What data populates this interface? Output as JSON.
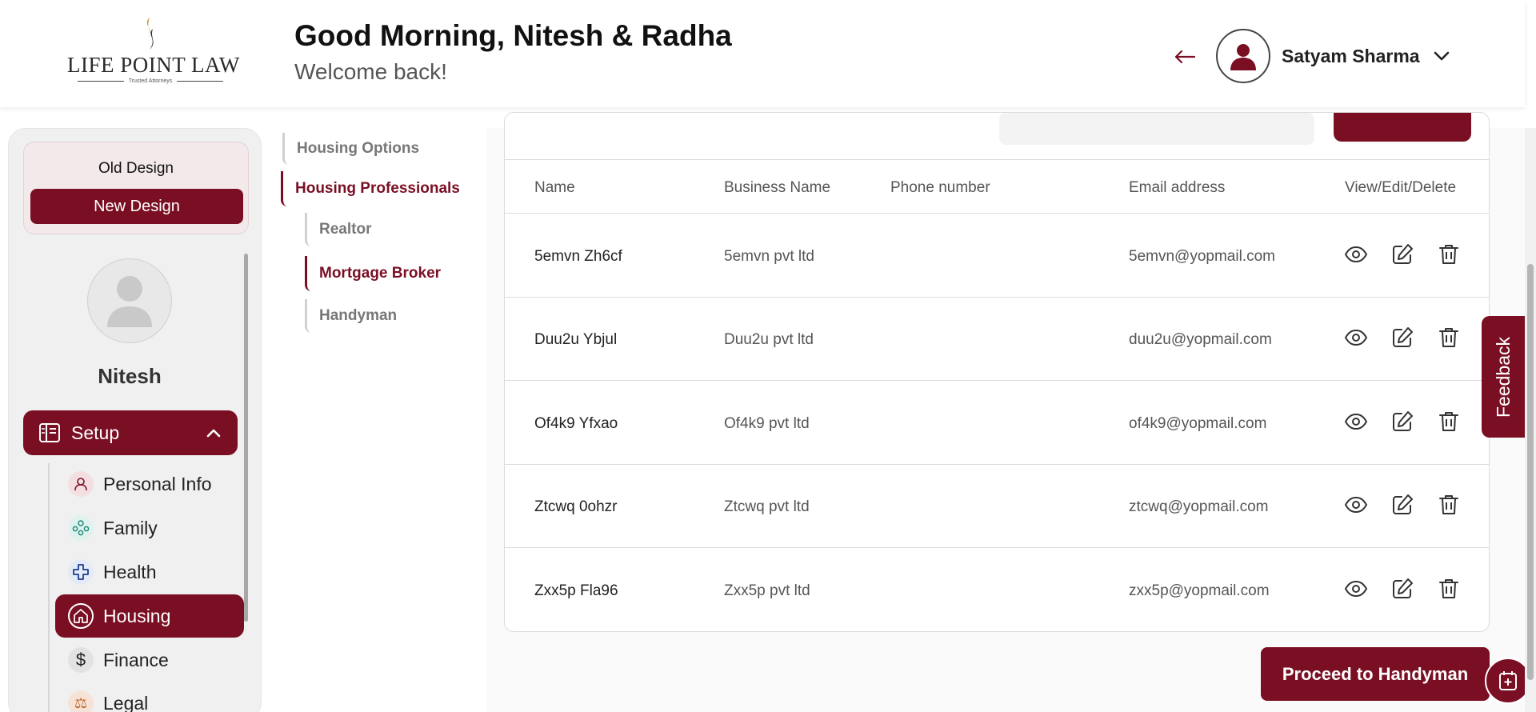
{
  "header": {
    "logo_text": "LIFE POINT LAW",
    "logo_tagline": "Trusted Attorneys",
    "greeting": "Good Morning, Nitesh & Radha",
    "subtitle": "Welcome back!",
    "user_name": "Satyam Sharma"
  },
  "sidebar": {
    "old_design": "Old Design",
    "new_design": "New Design",
    "profile_name": "Nitesh",
    "setup_label": "Setup",
    "items": [
      {
        "label": "Personal Info",
        "icon": "person-icon"
      },
      {
        "label": "Family",
        "icon": "family-icon"
      },
      {
        "label": "Health",
        "icon": "health-cross-icon"
      },
      {
        "label": "Housing",
        "icon": "home-icon"
      },
      {
        "label": "Finance",
        "icon": "dollar-icon"
      },
      {
        "label": "Legal",
        "icon": "legal-icon"
      }
    ]
  },
  "subnav": {
    "housing_options": "Housing Options",
    "housing_professionals": "Housing Professionals",
    "realtor": "Realtor",
    "mortgage_broker": "Mortgage Broker",
    "handyman": "Handyman"
  },
  "table": {
    "columns": [
      "Name",
      "Business Name",
      "Phone number",
      "Email address",
      "View/Edit/Delete"
    ],
    "rows": [
      {
        "name": "5emvn Zh6cf",
        "business": "5emvn pvt ltd",
        "phone": "",
        "email": "5emvn@yopmail.com"
      },
      {
        "name": "Duu2u Ybjul",
        "business": "Duu2u pvt ltd",
        "phone": "",
        "email": "duu2u@yopmail.com"
      },
      {
        "name": "Of4k9 Yfxao",
        "business": "Of4k9 pvt ltd",
        "phone": "",
        "email": "of4k9@yopmail.com"
      },
      {
        "name": "Ztcwq 0ohzr",
        "business": "Ztcwq pvt ltd",
        "phone": "",
        "email": "ztcwq@yopmail.com"
      },
      {
        "name": "Zxx5p Fla96",
        "business": "Zxx5p pvt ltd",
        "phone": "",
        "email": "zxx5p@yopmail.com"
      }
    ]
  },
  "proceed_label": "Proceed to Handyman",
  "feedback_label": "Feedback",
  "colors": {
    "brand": "#7a0f24",
    "logo_gold": "#c8892a"
  }
}
